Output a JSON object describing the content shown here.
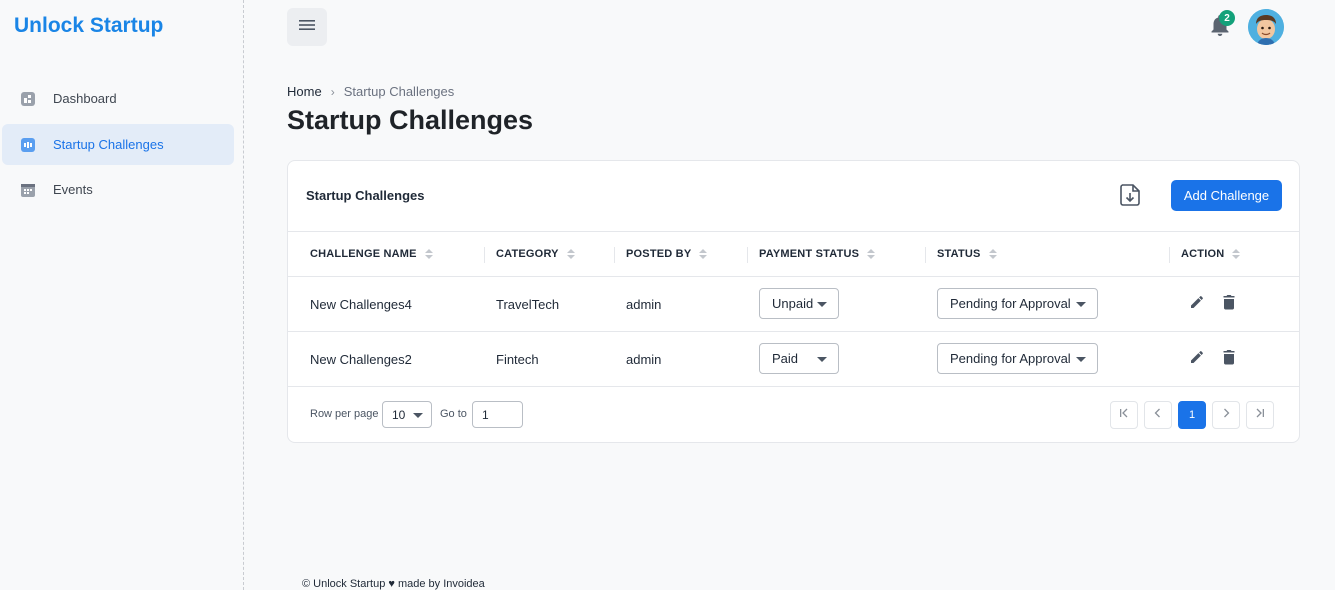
{
  "brand": "Unlock Startup",
  "sidebar": {
    "items": [
      {
        "label": "Dashboard",
        "icon": "dashboard-icon",
        "active": false
      },
      {
        "label": "Startup Challenges",
        "icon": "challenges-icon",
        "active": true
      },
      {
        "label": "Events",
        "icon": "calendar-icon",
        "active": false
      }
    ]
  },
  "header": {
    "notification_count": "2",
    "menu_icon": "hamburger-icon",
    "bell_icon": "bell-icon",
    "avatar": "user-avatar"
  },
  "breadcrumb": {
    "home": "Home",
    "separator": "›",
    "current": "Startup Challenges"
  },
  "page_title": "Startup Challenges",
  "card": {
    "title": "Startup Challenges",
    "export_icon": "download-file-icon",
    "add_button": "Add Challenge"
  },
  "table": {
    "columns": [
      "CHALLENGE NAME",
      "CATEGORY",
      "POSTED BY",
      "PAYMENT STATUS",
      "STATUS",
      "ACTION"
    ],
    "rows": [
      {
        "name": "New Challenges4",
        "category": "TravelTech",
        "posted_by": "admin",
        "payment_status": "Unpaid",
        "status": "Pending for Approval"
      },
      {
        "name": "New Challenges2",
        "category": "Fintech",
        "posted_by": "admin",
        "payment_status": "Paid",
        "status": "Pending for Approval"
      }
    ]
  },
  "pagination": {
    "rows_per_page_label": "Row per page",
    "rows_per_page": "10",
    "goto_label": "Go to",
    "goto_value": "1",
    "current_page": "1"
  },
  "footer": "© Unlock Startup ♥ made by Invoidea",
  "colors": {
    "accent": "#1a73e8",
    "brand": "#1a85e6",
    "badge": "#13a17a",
    "active_nav_bg": "#e3ecf8"
  }
}
